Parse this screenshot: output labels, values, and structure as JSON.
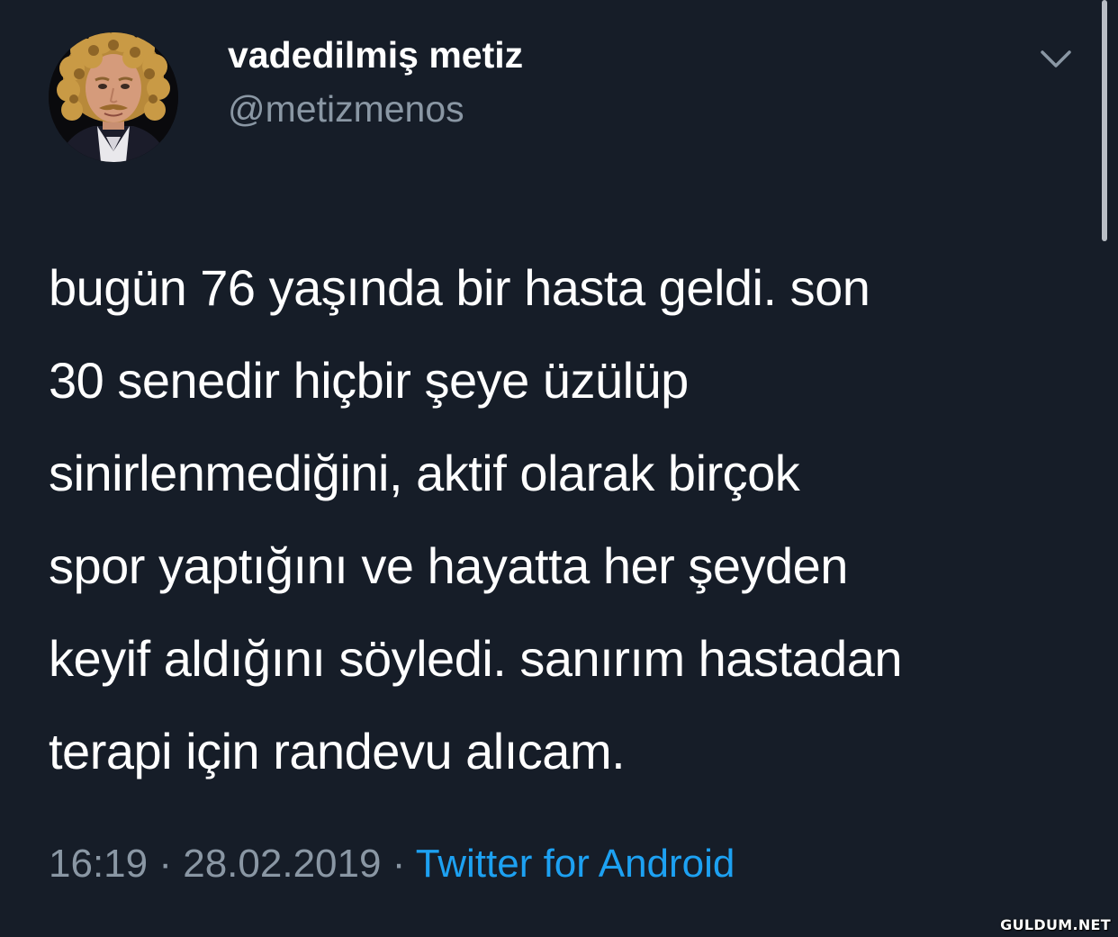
{
  "author": {
    "display_name": "vadedilmiş metiz",
    "handle": "@metizmenos",
    "avatar_icon": "profile-photo-curly-hair"
  },
  "tweet": {
    "lines": [
      "bugün 76 yaşında bir hasta geldi. son",
      "30 senedir hiçbir şeye üzülüp",
      "sinirlenmediğini, aktif olarak birçok",
      "spor yaptığını ve hayatta her şeyden",
      "keyif aldığını söyledi. sanırım hastadan",
      "terapi için randevu alıcam."
    ],
    "time": "16:19",
    "date": "28.02.2019",
    "separator": "·",
    "source": "Twitter for Android"
  },
  "menu_icon": "chevron-down-icon",
  "watermark": "GULDUM.NET",
  "colors": {
    "background": "#161d28",
    "text": "#ffffff",
    "secondary": "#8a97a4",
    "link": "#1da1f2"
  }
}
